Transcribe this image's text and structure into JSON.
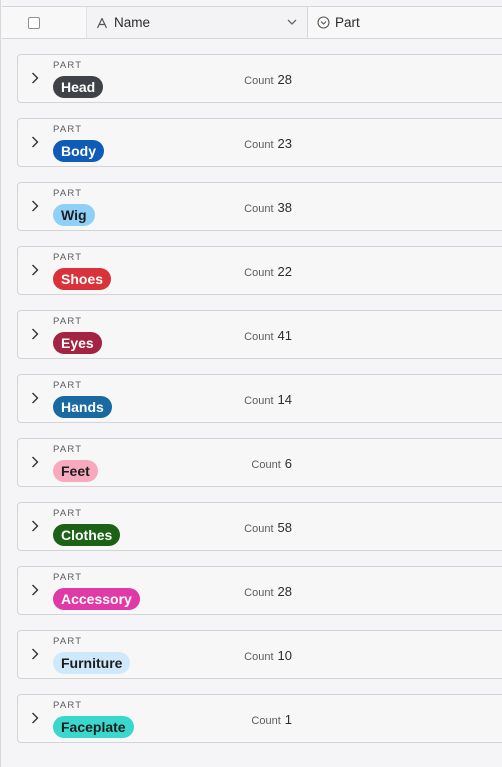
{
  "header": {
    "name_label": "Name",
    "part_label": "Part"
  },
  "count_label": "Count",
  "group_field_label": "PART",
  "groups": [
    {
      "label": "Head",
      "count": "28",
      "bg": "#3f4348",
      "fg": "#ffffff"
    },
    {
      "label": "Body",
      "count": "23",
      "bg": "#0f5bb8",
      "fg": "#ffffff"
    },
    {
      "label": "Wig",
      "count": "38",
      "bg": "#8fd0f7",
      "fg": "#1d1d1f"
    },
    {
      "label": "Shoes",
      "count": "22",
      "bg": "#d9323a",
      "fg": "#ffffff"
    },
    {
      "label": "Eyes",
      "count": "41",
      "bg": "#a32340",
      "fg": "#ffffff"
    },
    {
      "label": "Hands",
      "count": "14",
      "bg": "#186aa0",
      "fg": "#ffffff"
    },
    {
      "label": "Feet",
      "count": "6",
      "bg": "#f7a9be",
      "fg": "#1d1d1f"
    },
    {
      "label": "Clothes",
      "count": "58",
      "bg": "#1b6216",
      "fg": "#ffffff"
    },
    {
      "label": "Accessory",
      "count": "28",
      "bg": "#e03aa6",
      "fg": "#ffffff"
    },
    {
      "label": "Furniture",
      "count": "10",
      "bg": "#cfe9fb",
      "fg": "#1d1d1f"
    },
    {
      "label": "Faceplate",
      "count": "1",
      "bg": "#3ad8cc",
      "fg": "#1d1d1f"
    }
  ]
}
